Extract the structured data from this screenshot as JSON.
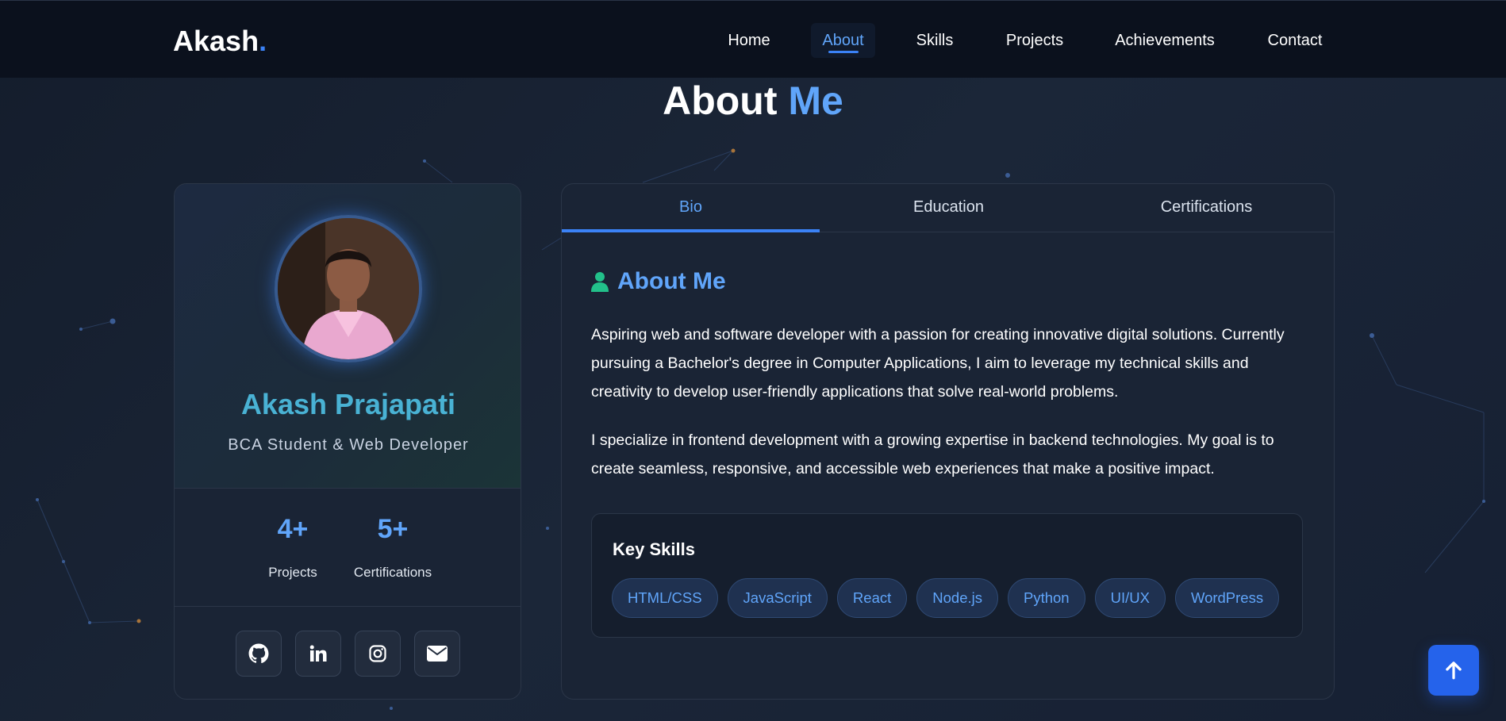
{
  "brand": {
    "name": "Akash",
    "dot": "."
  },
  "nav": {
    "items": [
      {
        "label": "Home"
      },
      {
        "label": "About",
        "active": true
      },
      {
        "label": "Skills"
      },
      {
        "label": "Projects"
      },
      {
        "label": "Achievements"
      },
      {
        "label": "Contact"
      }
    ]
  },
  "section": {
    "title_main": "About",
    "title_accent": "Me"
  },
  "profile": {
    "name": "Akash Prajapati",
    "role": "BCA Student & Web Developer",
    "stats": [
      {
        "value": "4+",
        "label": "Projects"
      },
      {
        "value": "5+",
        "label": "Certifications"
      }
    ],
    "socials": [
      {
        "icon": "github-icon"
      },
      {
        "icon": "linkedin-icon"
      },
      {
        "icon": "instagram-icon"
      },
      {
        "icon": "mail-icon"
      }
    ]
  },
  "tabs": {
    "items": [
      {
        "label": "Bio",
        "active": true
      },
      {
        "label": "Education"
      },
      {
        "label": "Certifications"
      }
    ]
  },
  "bio": {
    "title": "About Me",
    "icon": "user-icon",
    "paragraphs": [
      "Aspiring web and software developer with a passion for creating innovative digital solutions. Currently pursuing a Bachelor's degree in Computer Applications, I aim to leverage my technical skills and creativity to develop user-friendly applications that solve real-world problems.",
      "I specialize in frontend development with a growing expertise in backend technologies. My goal is to create seamless, responsive, and accessible web experiences that make a positive impact."
    ],
    "skills_title": "Key Skills",
    "skills": [
      "HTML/CSS",
      "JavaScript",
      "React",
      "Node.js",
      "Python",
      "UI/UX",
      "WordPress"
    ]
  },
  "colors": {
    "accent": "#3b82f6",
    "accent_light": "#60a5fa",
    "background": "#141d2c",
    "navbar": "#0b111d"
  },
  "scroll_top": {
    "icon": "arrow-up-icon"
  }
}
